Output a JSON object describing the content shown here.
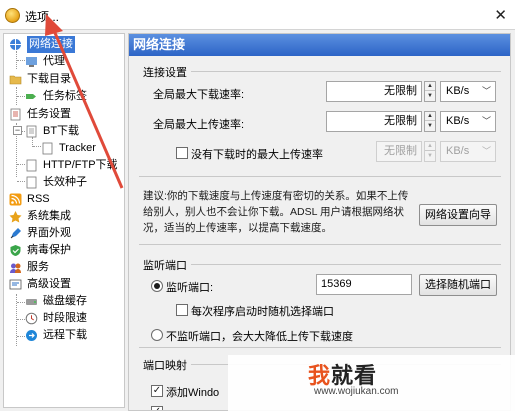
{
  "window": {
    "title": "选项..."
  },
  "sidebar": {
    "items": [
      {
        "label": "网络连接",
        "icon": "network-icon"
      },
      {
        "label": "代理",
        "icon": "proxy-icon"
      },
      {
        "label": "下载目录",
        "icon": "folder-icon"
      },
      {
        "label": "任务标签",
        "icon": "tag-icon"
      },
      {
        "label": "任务设置",
        "icon": "task-settings-icon"
      },
      {
        "label": "BT下载",
        "icon": "bt-icon"
      },
      {
        "label": "Tracker",
        "icon": "doc-icon"
      },
      {
        "label": "HTTP/FTP下载",
        "icon": "doc-icon"
      },
      {
        "label": "长效种子",
        "icon": "doc-icon"
      },
      {
        "label": "RSS",
        "icon": "rss-icon"
      },
      {
        "label": "系统集成",
        "icon": "system-icon"
      },
      {
        "label": "界面外观",
        "icon": "appearance-icon"
      },
      {
        "label": "病毒保护",
        "icon": "shield-icon"
      },
      {
        "label": "服务",
        "icon": "service-icon"
      },
      {
        "label": "高级设置",
        "icon": "advanced-icon"
      },
      {
        "label": "磁盘缓存",
        "icon": "disk-icon"
      },
      {
        "label": "时段限速",
        "icon": "clock-icon"
      },
      {
        "label": "远程下载",
        "icon": "remote-icon"
      }
    ]
  },
  "panel": {
    "title": "网络连接",
    "connection": {
      "section_title": "连接设置",
      "max_download_label": "全局最大下载速率:",
      "max_download_value": "无限制",
      "max_download_unit": "KB/s",
      "max_upload_label": "全局最大上传速率:",
      "max_upload_value": "无限制",
      "max_upload_unit": "KB/s",
      "no_task_upload_label": "没有下载时的最大上传速率",
      "no_task_upload_value": "无限制",
      "no_task_upload_unit": "KB/s",
      "advice_text": "建议:你的下载速度与上传速度有密切的关系。如果不上传给别人，别人也不会让你下载。ADSL 用户请根据网络状况，适当的上传速率，以提高下载速度。",
      "wizard_button": "网络设置向导"
    },
    "listen": {
      "section_title": "监听端口",
      "listen_port_label": "监听端口:",
      "port_value": "15369",
      "random_port_button": "选择随机端口",
      "random_on_start_label": "每次程序启动时随机选择端口",
      "no_listen_label": "不监听端口，会大大降低上传下载速度"
    },
    "port_mapping": {
      "section_title": "端口映射",
      "add_windows_label": "添加Windo"
    }
  },
  "watermark": {
    "brand_first": "我",
    "brand_rest": "就看",
    "url": "www.wojiukan.com"
  },
  "colors": {
    "selection": "#3a78d6",
    "header": "#2d64c6",
    "arrow": "#e04a3a"
  }
}
